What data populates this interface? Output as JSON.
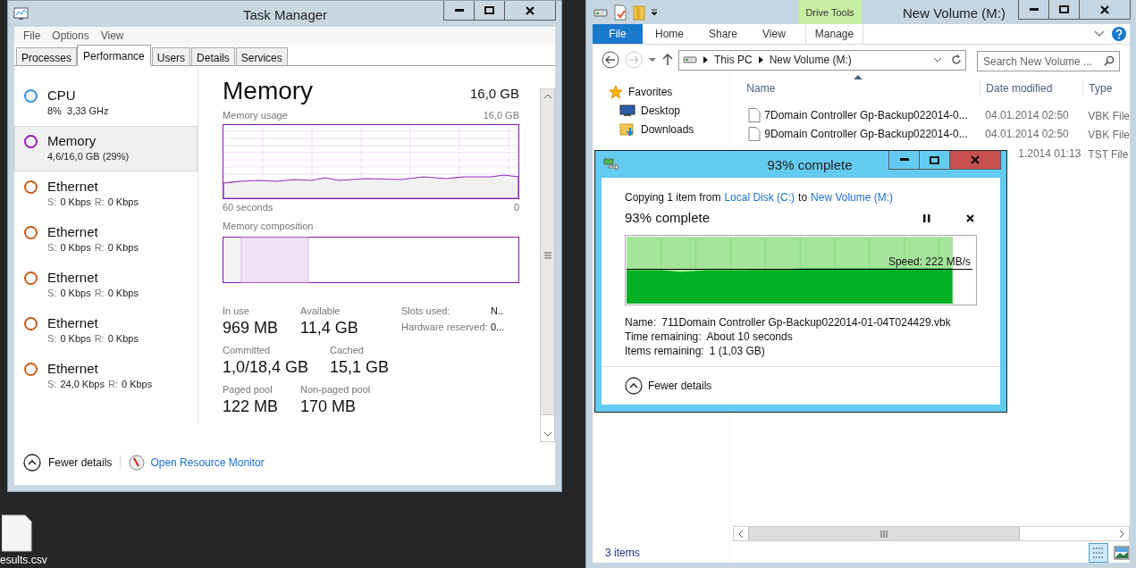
{
  "task_manager": {
    "title": "Task Manager",
    "menu": [
      "File",
      "Options",
      "View"
    ],
    "tabs": [
      {
        "label": "Processes",
        "selected": false
      },
      {
        "label": "Performance",
        "selected": true
      },
      {
        "label": "Users",
        "selected": false
      },
      {
        "label": "Details",
        "selected": false
      },
      {
        "label": "Services",
        "selected": false
      }
    ],
    "resources": [
      {
        "kind": "cpu",
        "name": "CPU",
        "detail": "8%  3,33 GHz",
        "color": "#3b8fd6",
        "selected": false
      },
      {
        "kind": "memory",
        "name": "Memory",
        "detail": "4,6/16,0 GB (29%)",
        "color": "#8e1eb0",
        "selected": true
      },
      {
        "kind": "network",
        "name": "Ethernet",
        "send_label": "S:",
        "send": "0 Kbps",
        "recv_label": "R:",
        "recv": "0 Kbps",
        "color": "#c65f1d",
        "selected": false
      },
      {
        "kind": "network",
        "name": "Ethernet",
        "send_label": "S:",
        "send": "0 Kbps",
        "recv_label": "R:",
        "recv": "0 Kbps",
        "color": "#c65f1d",
        "selected": false
      },
      {
        "kind": "network",
        "name": "Ethernet",
        "send_label": "S:",
        "send": "0 Kbps",
        "recv_label": "R:",
        "recv": "0 Kbps",
        "color": "#c65f1d",
        "selected": false
      },
      {
        "kind": "network",
        "name": "Ethernet",
        "send_label": "S:",
        "send": "0 Kbps",
        "recv_label": "R:",
        "recv": "0 Kbps",
        "color": "#c65f1d",
        "selected": false
      },
      {
        "kind": "network",
        "name": "Ethernet",
        "send_label": "S:",
        "send": "24,0 Kbps",
        "recv_label": "R:",
        "recv": "0 Kbps",
        "color": "#c65f1d",
        "selected": false
      }
    ],
    "heading": "Memory",
    "total": "16,0 GB",
    "usage_label": "Memory usage",
    "usage_max": "16,0 GB",
    "time_label": "60 seconds",
    "time_end": "0",
    "composition_label": "Memory composition",
    "stats": [
      {
        "label": "In use",
        "value": "969 MB"
      },
      {
        "label": "Available",
        "value": "11,4 GB"
      },
      {
        "label": "Committed",
        "value": "1,0/18,4 GB"
      },
      {
        "label": "Cached",
        "value": "15,1 GB"
      },
      {
        "label": "Paged pool",
        "value": "122 MB"
      },
      {
        "label": "Non-paged pool",
        "value": "170 MB"
      }
    ],
    "side_stats": [
      {
        "label": "Slots used:",
        "value": "N.."
      },
      {
        "label": "Hardware reserved:",
        "value": "0..."
      }
    ],
    "fewer_details": "Fewer details",
    "resource_monitor": "Open Resource Monitor"
  },
  "explorer": {
    "title": "New Volume (M:)",
    "context_tab": "Drive Tools",
    "ribbon_tabs": [
      {
        "label": "File",
        "kind": "file"
      },
      {
        "label": "Home",
        "kind": "tab"
      },
      {
        "label": "Share",
        "kind": "tab"
      },
      {
        "label": "View",
        "kind": "tab"
      },
      {
        "label": "Manage",
        "kind": "context"
      }
    ],
    "breadcrumb": [
      "This PC",
      "New Volume (M:)"
    ],
    "search": {
      "placeholder": "Search New Volume ..."
    },
    "nav": [
      {
        "label": "Favorites",
        "kind": "favorites"
      },
      {
        "label": "Desktop",
        "kind": "desktop"
      },
      {
        "label": "Downloads",
        "kind": "downloads"
      }
    ],
    "columns": [
      "Name",
      "Date modified",
      "Type"
    ],
    "rows": [
      {
        "name": "7Domain Controller Gp-Backup022014-0...",
        "date": "04.01.2014 02:50",
        "type": "VBK File"
      },
      {
        "name": "9Domain Controller Gp-Backup022014-0...",
        "date": "04.01.2014 02:50",
        "type": "VBK File"
      },
      {
        "date": "1.2014 01:13",
        "type": "TST File"
      }
    ],
    "status": "3 items"
  },
  "copy_dialog": {
    "title": "93% complete",
    "copying": "Copying 1 item from",
    "source": "Local Disk (C:)",
    "to": "to",
    "destination": "New Volume (M:)",
    "progress": "93% complete",
    "level": 0.93,
    "speed": "Speed: 222 MB/s",
    "details": [
      {
        "label": "Name:",
        "value": "711Domain Controller Gp-Backup022014-01-04T024429.vbk"
      },
      {
        "label": "Time remaining:",
        "value": "About 10 seconds"
      },
      {
        "label": "Items remaining:",
        "value": "1 (1,03 GB)"
      }
    ],
    "fewer_details": "Fewer details"
  },
  "desktop_icons": [
    {
      "label": "esults.csv"
    }
  ]
}
